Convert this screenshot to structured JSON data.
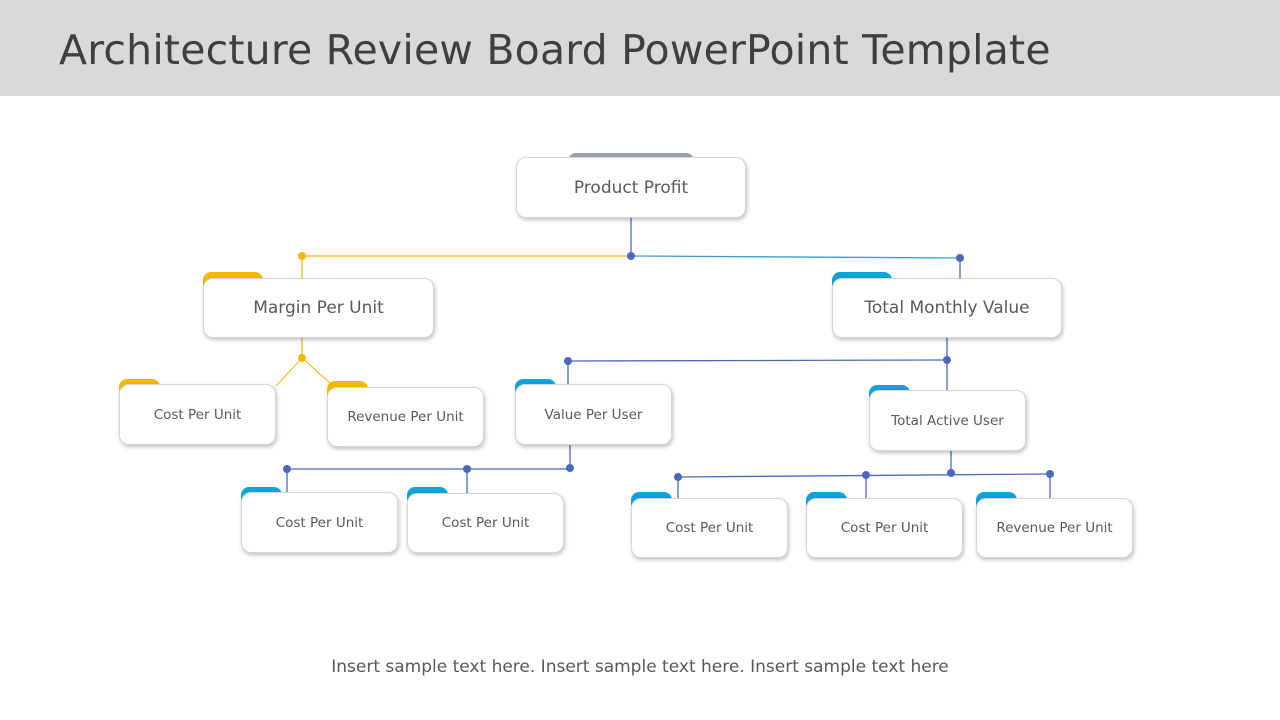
{
  "title": "Architecture Review Board PowerPoint Template",
  "colors": {
    "yellow": "#f5b800",
    "blue": "#0fa3d9",
    "connector_blue": "#4a69bd",
    "gray_tab": "#9ca3ad"
  },
  "nodes": {
    "root": "Product Profit",
    "margin": "Margin Per Unit",
    "margin_cost": "Cost Per Unit",
    "margin_revenue": "Revenue Per Unit",
    "monthly": "Total Monthly Value",
    "value_user": "Value Per User",
    "value_user_cost1": "Cost Per Unit",
    "value_user_cost2": "Cost Per Unit",
    "active_user": "Total Active User",
    "active_cost1": "Cost Per Unit",
    "active_cost2": "Cost Per Unit",
    "active_revenue": "Revenue Per Unit"
  },
  "footer": "Insert sample text here. Insert sample text here. Insert sample text here"
}
